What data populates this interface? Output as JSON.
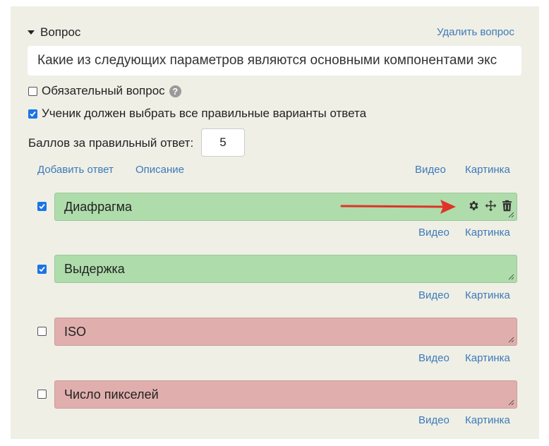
{
  "question": {
    "title": "Вопрос",
    "delete_label": "Удалить вопрос",
    "text": "Какие из следующих параметров являются основными компонентами экс",
    "required_label": "Обязательный вопрос",
    "required_checked": false,
    "all_correct_label": "Ученик должен выбрать все правильные варианты ответа",
    "all_correct_checked": true,
    "points_label": "Баллов за правильный ответ:",
    "points_value": "5"
  },
  "actions": {
    "add_answer": "Добавить ответ",
    "description": "Описание",
    "video": "Видео",
    "picture": "Картинка"
  },
  "answers": [
    {
      "text": "Диафрагма",
      "checked": true,
      "status": "correct",
      "video": "Видео",
      "picture": "Картинка"
    },
    {
      "text": "Выдержка",
      "checked": true,
      "status": "correct",
      "video": "Видео",
      "picture": "Картинка"
    },
    {
      "text": "ISO",
      "checked": false,
      "status": "wrong",
      "video": "Видео",
      "picture": "Картинка"
    },
    {
      "text": "Число пикселей",
      "checked": false,
      "status": "wrong",
      "video": "Видео",
      "picture": "Картинка"
    }
  ],
  "icons": [
    "caret-down-icon",
    "help-icon",
    "gear-icon",
    "move-icon",
    "trash-icon",
    "resize-handle-icon",
    "red-arrow-icon"
  ],
  "colors": {
    "panel_bg": "#efefe6",
    "link": "#3d7ab8",
    "correct_bg": "#aedcab",
    "wrong_bg": "#e0afad",
    "checkbox": "#1a73e8",
    "arrow": "#e0332a"
  }
}
